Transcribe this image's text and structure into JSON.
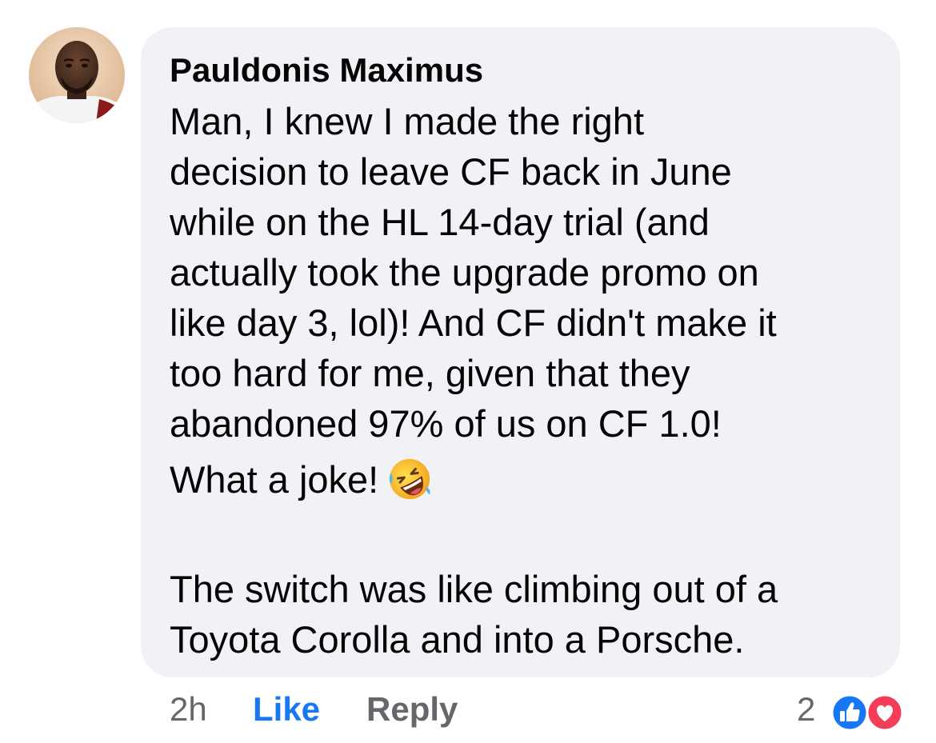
{
  "comment": {
    "author": "Pauldonis Maximus",
    "avatar_icon": "profile-photo-avatar",
    "paragraphs": [
      [
        "Man, I knew I made the right",
        "decision to leave CF back in June",
        "while on the HL 14-day trial (and",
        "actually took the upgrade promo on",
        "like day 3, lol)! And CF didn't make it",
        "too hard for me, given that they",
        "abandoned 97% of us on CF 1.0!"
      ],
      [
        "What a joke!"
      ],
      [
        "The switch was like climbing out of a",
        "Toyota Corolla and into a Porsche."
      ]
    ],
    "emoji_icon": "rolling-on-the-floor-laughing-emoji"
  },
  "actions": {
    "time": "2h",
    "like_label": "Like",
    "reply_label": "Reply"
  },
  "reactions": {
    "count": "2",
    "icons": [
      "like-reaction-icon",
      "love-reaction-icon"
    ],
    "like_color": "#1877f2",
    "love_color": "#f33e58"
  },
  "colors": {
    "bubble": "#f0f2f5",
    "link_blue": "#1877f2",
    "meta_gray": "#65676b"
  }
}
